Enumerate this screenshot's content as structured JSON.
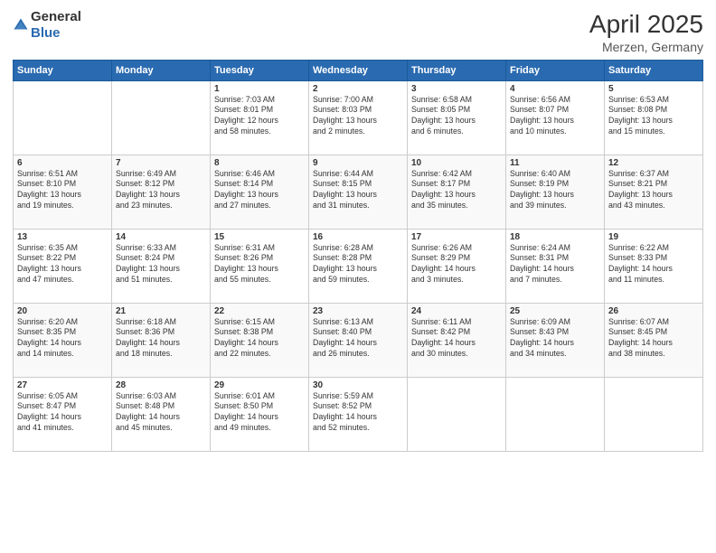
{
  "logo": {
    "general": "General",
    "blue": "Blue"
  },
  "header": {
    "title": "April 2025",
    "subtitle": "Merzen, Germany"
  },
  "days_of_week": [
    "Sunday",
    "Monday",
    "Tuesday",
    "Wednesday",
    "Thursday",
    "Friday",
    "Saturday"
  ],
  "weeks": [
    [
      {
        "day": "",
        "info": ""
      },
      {
        "day": "",
        "info": ""
      },
      {
        "day": "1",
        "info": "Sunrise: 7:03 AM\nSunset: 8:01 PM\nDaylight: 12 hours\nand 58 minutes."
      },
      {
        "day": "2",
        "info": "Sunrise: 7:00 AM\nSunset: 8:03 PM\nDaylight: 13 hours\nand 2 minutes."
      },
      {
        "day": "3",
        "info": "Sunrise: 6:58 AM\nSunset: 8:05 PM\nDaylight: 13 hours\nand 6 minutes."
      },
      {
        "day": "4",
        "info": "Sunrise: 6:56 AM\nSunset: 8:07 PM\nDaylight: 13 hours\nand 10 minutes."
      },
      {
        "day": "5",
        "info": "Sunrise: 6:53 AM\nSunset: 8:08 PM\nDaylight: 13 hours\nand 15 minutes."
      }
    ],
    [
      {
        "day": "6",
        "info": "Sunrise: 6:51 AM\nSunset: 8:10 PM\nDaylight: 13 hours\nand 19 minutes."
      },
      {
        "day": "7",
        "info": "Sunrise: 6:49 AM\nSunset: 8:12 PM\nDaylight: 13 hours\nand 23 minutes."
      },
      {
        "day": "8",
        "info": "Sunrise: 6:46 AM\nSunset: 8:14 PM\nDaylight: 13 hours\nand 27 minutes."
      },
      {
        "day": "9",
        "info": "Sunrise: 6:44 AM\nSunset: 8:15 PM\nDaylight: 13 hours\nand 31 minutes."
      },
      {
        "day": "10",
        "info": "Sunrise: 6:42 AM\nSunset: 8:17 PM\nDaylight: 13 hours\nand 35 minutes."
      },
      {
        "day": "11",
        "info": "Sunrise: 6:40 AM\nSunset: 8:19 PM\nDaylight: 13 hours\nand 39 minutes."
      },
      {
        "day": "12",
        "info": "Sunrise: 6:37 AM\nSunset: 8:21 PM\nDaylight: 13 hours\nand 43 minutes."
      }
    ],
    [
      {
        "day": "13",
        "info": "Sunrise: 6:35 AM\nSunset: 8:22 PM\nDaylight: 13 hours\nand 47 minutes."
      },
      {
        "day": "14",
        "info": "Sunrise: 6:33 AM\nSunset: 8:24 PM\nDaylight: 13 hours\nand 51 minutes."
      },
      {
        "day": "15",
        "info": "Sunrise: 6:31 AM\nSunset: 8:26 PM\nDaylight: 13 hours\nand 55 minutes."
      },
      {
        "day": "16",
        "info": "Sunrise: 6:28 AM\nSunset: 8:28 PM\nDaylight: 13 hours\nand 59 minutes."
      },
      {
        "day": "17",
        "info": "Sunrise: 6:26 AM\nSunset: 8:29 PM\nDaylight: 14 hours\nand 3 minutes."
      },
      {
        "day": "18",
        "info": "Sunrise: 6:24 AM\nSunset: 8:31 PM\nDaylight: 14 hours\nand 7 minutes."
      },
      {
        "day": "19",
        "info": "Sunrise: 6:22 AM\nSunset: 8:33 PM\nDaylight: 14 hours\nand 11 minutes."
      }
    ],
    [
      {
        "day": "20",
        "info": "Sunrise: 6:20 AM\nSunset: 8:35 PM\nDaylight: 14 hours\nand 14 minutes."
      },
      {
        "day": "21",
        "info": "Sunrise: 6:18 AM\nSunset: 8:36 PM\nDaylight: 14 hours\nand 18 minutes."
      },
      {
        "day": "22",
        "info": "Sunrise: 6:15 AM\nSunset: 8:38 PM\nDaylight: 14 hours\nand 22 minutes."
      },
      {
        "day": "23",
        "info": "Sunrise: 6:13 AM\nSunset: 8:40 PM\nDaylight: 14 hours\nand 26 minutes."
      },
      {
        "day": "24",
        "info": "Sunrise: 6:11 AM\nSunset: 8:42 PM\nDaylight: 14 hours\nand 30 minutes."
      },
      {
        "day": "25",
        "info": "Sunrise: 6:09 AM\nSunset: 8:43 PM\nDaylight: 14 hours\nand 34 minutes."
      },
      {
        "day": "26",
        "info": "Sunrise: 6:07 AM\nSunset: 8:45 PM\nDaylight: 14 hours\nand 38 minutes."
      }
    ],
    [
      {
        "day": "27",
        "info": "Sunrise: 6:05 AM\nSunset: 8:47 PM\nDaylight: 14 hours\nand 41 minutes."
      },
      {
        "day": "28",
        "info": "Sunrise: 6:03 AM\nSunset: 8:48 PM\nDaylight: 14 hours\nand 45 minutes."
      },
      {
        "day": "29",
        "info": "Sunrise: 6:01 AM\nSunset: 8:50 PM\nDaylight: 14 hours\nand 49 minutes."
      },
      {
        "day": "30",
        "info": "Sunrise: 5:59 AM\nSunset: 8:52 PM\nDaylight: 14 hours\nand 52 minutes."
      },
      {
        "day": "",
        "info": ""
      },
      {
        "day": "",
        "info": ""
      },
      {
        "day": "",
        "info": ""
      }
    ]
  ]
}
